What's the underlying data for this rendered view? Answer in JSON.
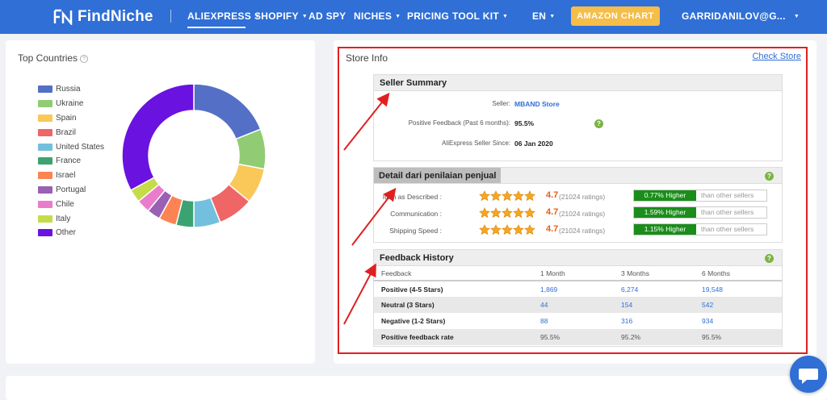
{
  "nav": {
    "logo_text": "FindNiche",
    "items": [
      {
        "label": "ALIEXPRESS",
        "caret": true,
        "active": true
      },
      {
        "label": "SHOPIFY",
        "caret": true
      },
      {
        "label": "AD SPY",
        "caret": false
      },
      {
        "label": "NICHES",
        "caret": true
      },
      {
        "label": "PRICING",
        "caret": false
      },
      {
        "label": "TOOL KIT",
        "caret": true
      }
    ],
    "language": "EN",
    "amazon_button": "AMAZON CHART",
    "user": "GARRIDANILOV@G...",
    "colors": {
      "bar": "#2f6fd6",
      "amazon": "#f6bd48"
    }
  },
  "top_countries": {
    "title": "Top Countries",
    "help_icon": "question-circle-icon"
  },
  "chart_data": {
    "type": "pie",
    "donut": true,
    "legend_position": "left",
    "categories": [
      "Russia",
      "Ukraine",
      "Spain",
      "Brazil",
      "United States",
      "France",
      "Israel",
      "Portugal",
      "Chile",
      "Italy",
      "Other"
    ],
    "values": [
      19.0,
      9.0,
      8.0,
      8.0,
      6.0,
      4.0,
      4.0,
      3.0,
      3.0,
      3.0,
      33.0
    ],
    "colors": [
      "#5470c6",
      "#91cc75",
      "#fac858",
      "#ee6666",
      "#73c0de",
      "#3ba272",
      "#fc8452",
      "#9a60b4",
      "#ea7ccc",
      "#c5dc4a",
      "#6a12e0"
    ]
  },
  "store_info": {
    "title": "Store Info",
    "check_store": "Check Store",
    "seller_summary": {
      "title": "Seller Summary",
      "seller_label": "Seller:",
      "seller_value": "MBAND Store",
      "positive_label": "Positive Feedback (Past 6 months):",
      "positive_value": "95.5%",
      "since_label": "AliExpress Seller Since:",
      "since_value": "06 Jan 2020"
    },
    "detail": {
      "title": "Detail dari penilaian penjual",
      "rows": [
        {
          "label": "Item as Described :",
          "rating": "4.7",
          "count": "(21024 ratings)",
          "compare": "0.77% Higher",
          "compare_text": "than other sellers"
        },
        {
          "label": "Communication :",
          "rating": "4.7",
          "count": "(21024 ratings)",
          "compare": "1.59% Higher",
          "compare_text": "than other sellers"
        },
        {
          "label": "Shipping Speed :",
          "rating": "4.7",
          "count": "(21024 ratings)",
          "compare": "1.15% Higher",
          "compare_text": "than other sellers"
        }
      ]
    },
    "feedback_history": {
      "title": "Feedback History",
      "headers": [
        "Feedback",
        "1 Month",
        "3 Months",
        "6 Months"
      ],
      "rows": [
        [
          "Positive (4-5 Stars)",
          "1,869",
          "6,274",
          "19,548"
        ],
        [
          "Neutral (3 Stars)",
          "44",
          "154",
          "542"
        ],
        [
          "Negative (1-2 Stars)",
          "88",
          "316",
          "934"
        ],
        [
          "Positive feedback rate",
          "95.5%",
          "95.2%",
          "95.5%"
        ]
      ]
    }
  },
  "chat_icon": "chat-bubble-icon"
}
